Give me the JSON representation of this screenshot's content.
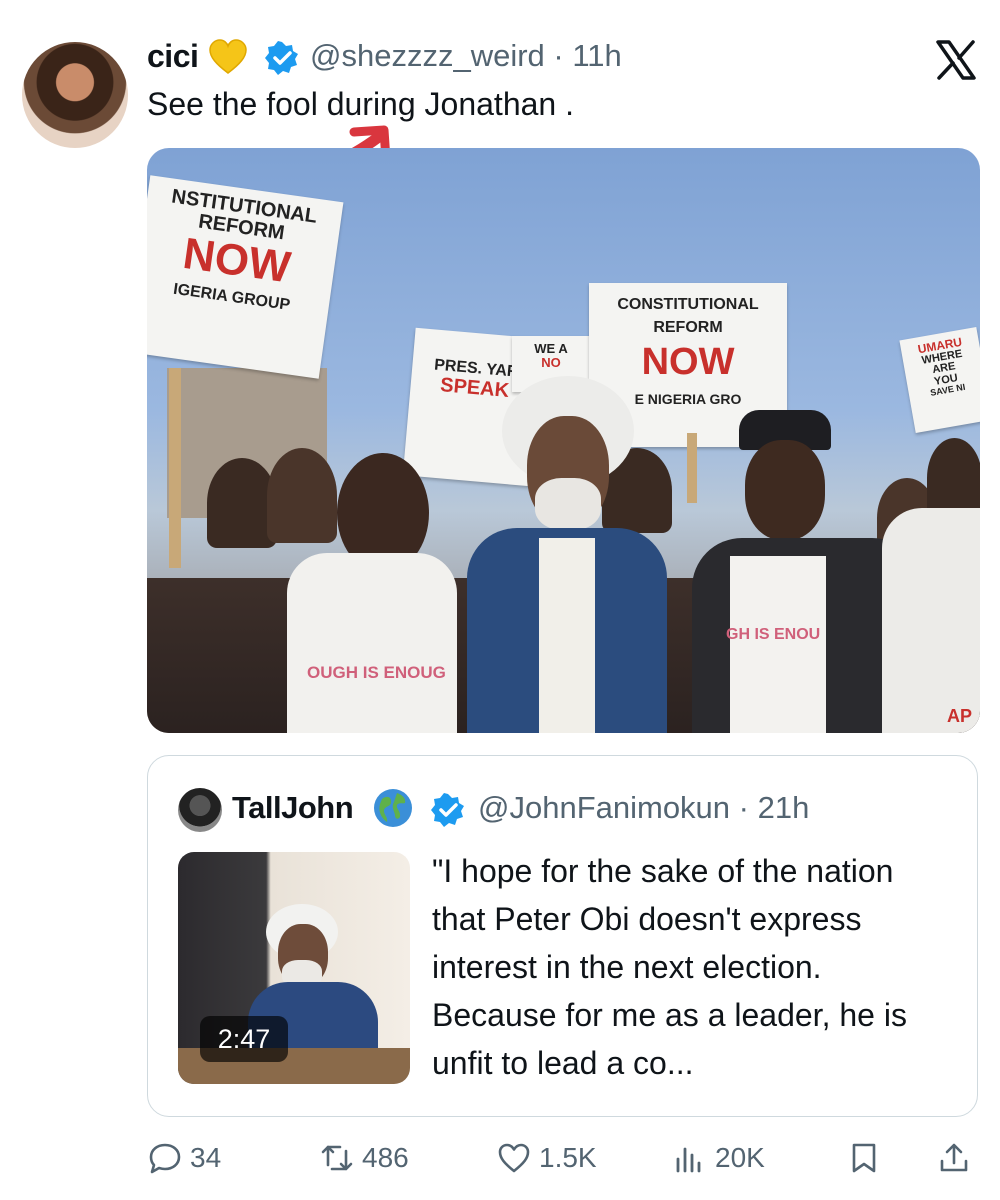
{
  "tweet": {
    "author_name": "cici",
    "author_emoji": "💛",
    "handle_time": "@shezzzz_weird · 11h",
    "text": "See the fool during Jonathan ."
  },
  "photo": {
    "sign_left": [
      "NSTITUTIONAL",
      "REFORM",
      "NOW",
      "IGERIA GROUP"
    ],
    "sign_mid": [
      "PRES. YAR",
      "SPEAK"
    ],
    "sign_we": [
      "WE A",
      "NO"
    ],
    "sign_main": [
      "CONSTITUTIONAL",
      "REFORM",
      "NOW",
      "E NIGERIA GRO"
    ],
    "sign_right": [
      "UMARU",
      "WHERE",
      "ARE",
      "YOU",
      "SAVE NI"
    ],
    "shirt_left": "OUGH IS ENOUG",
    "shirt_right": "GH IS ENOU",
    "watermark": "AP"
  },
  "quote": {
    "author_name": "TallJohn",
    "author_emoji": "🌍",
    "handle_time": "@JohnFanimokun · 21h",
    "video_duration": "2:47",
    "text": "\"I hope for the sake of the nation that Peter Obi doesn't express interest in the next election. Because for me as a leader, he is unfit to lead a co..."
  },
  "actions": {
    "replies": "34",
    "reposts": "486",
    "likes": "1.5K",
    "views": "20K"
  },
  "colors": {
    "verified": "#1d9bf0",
    "secondary_text": "#536471",
    "arrow": "#d9363e"
  }
}
